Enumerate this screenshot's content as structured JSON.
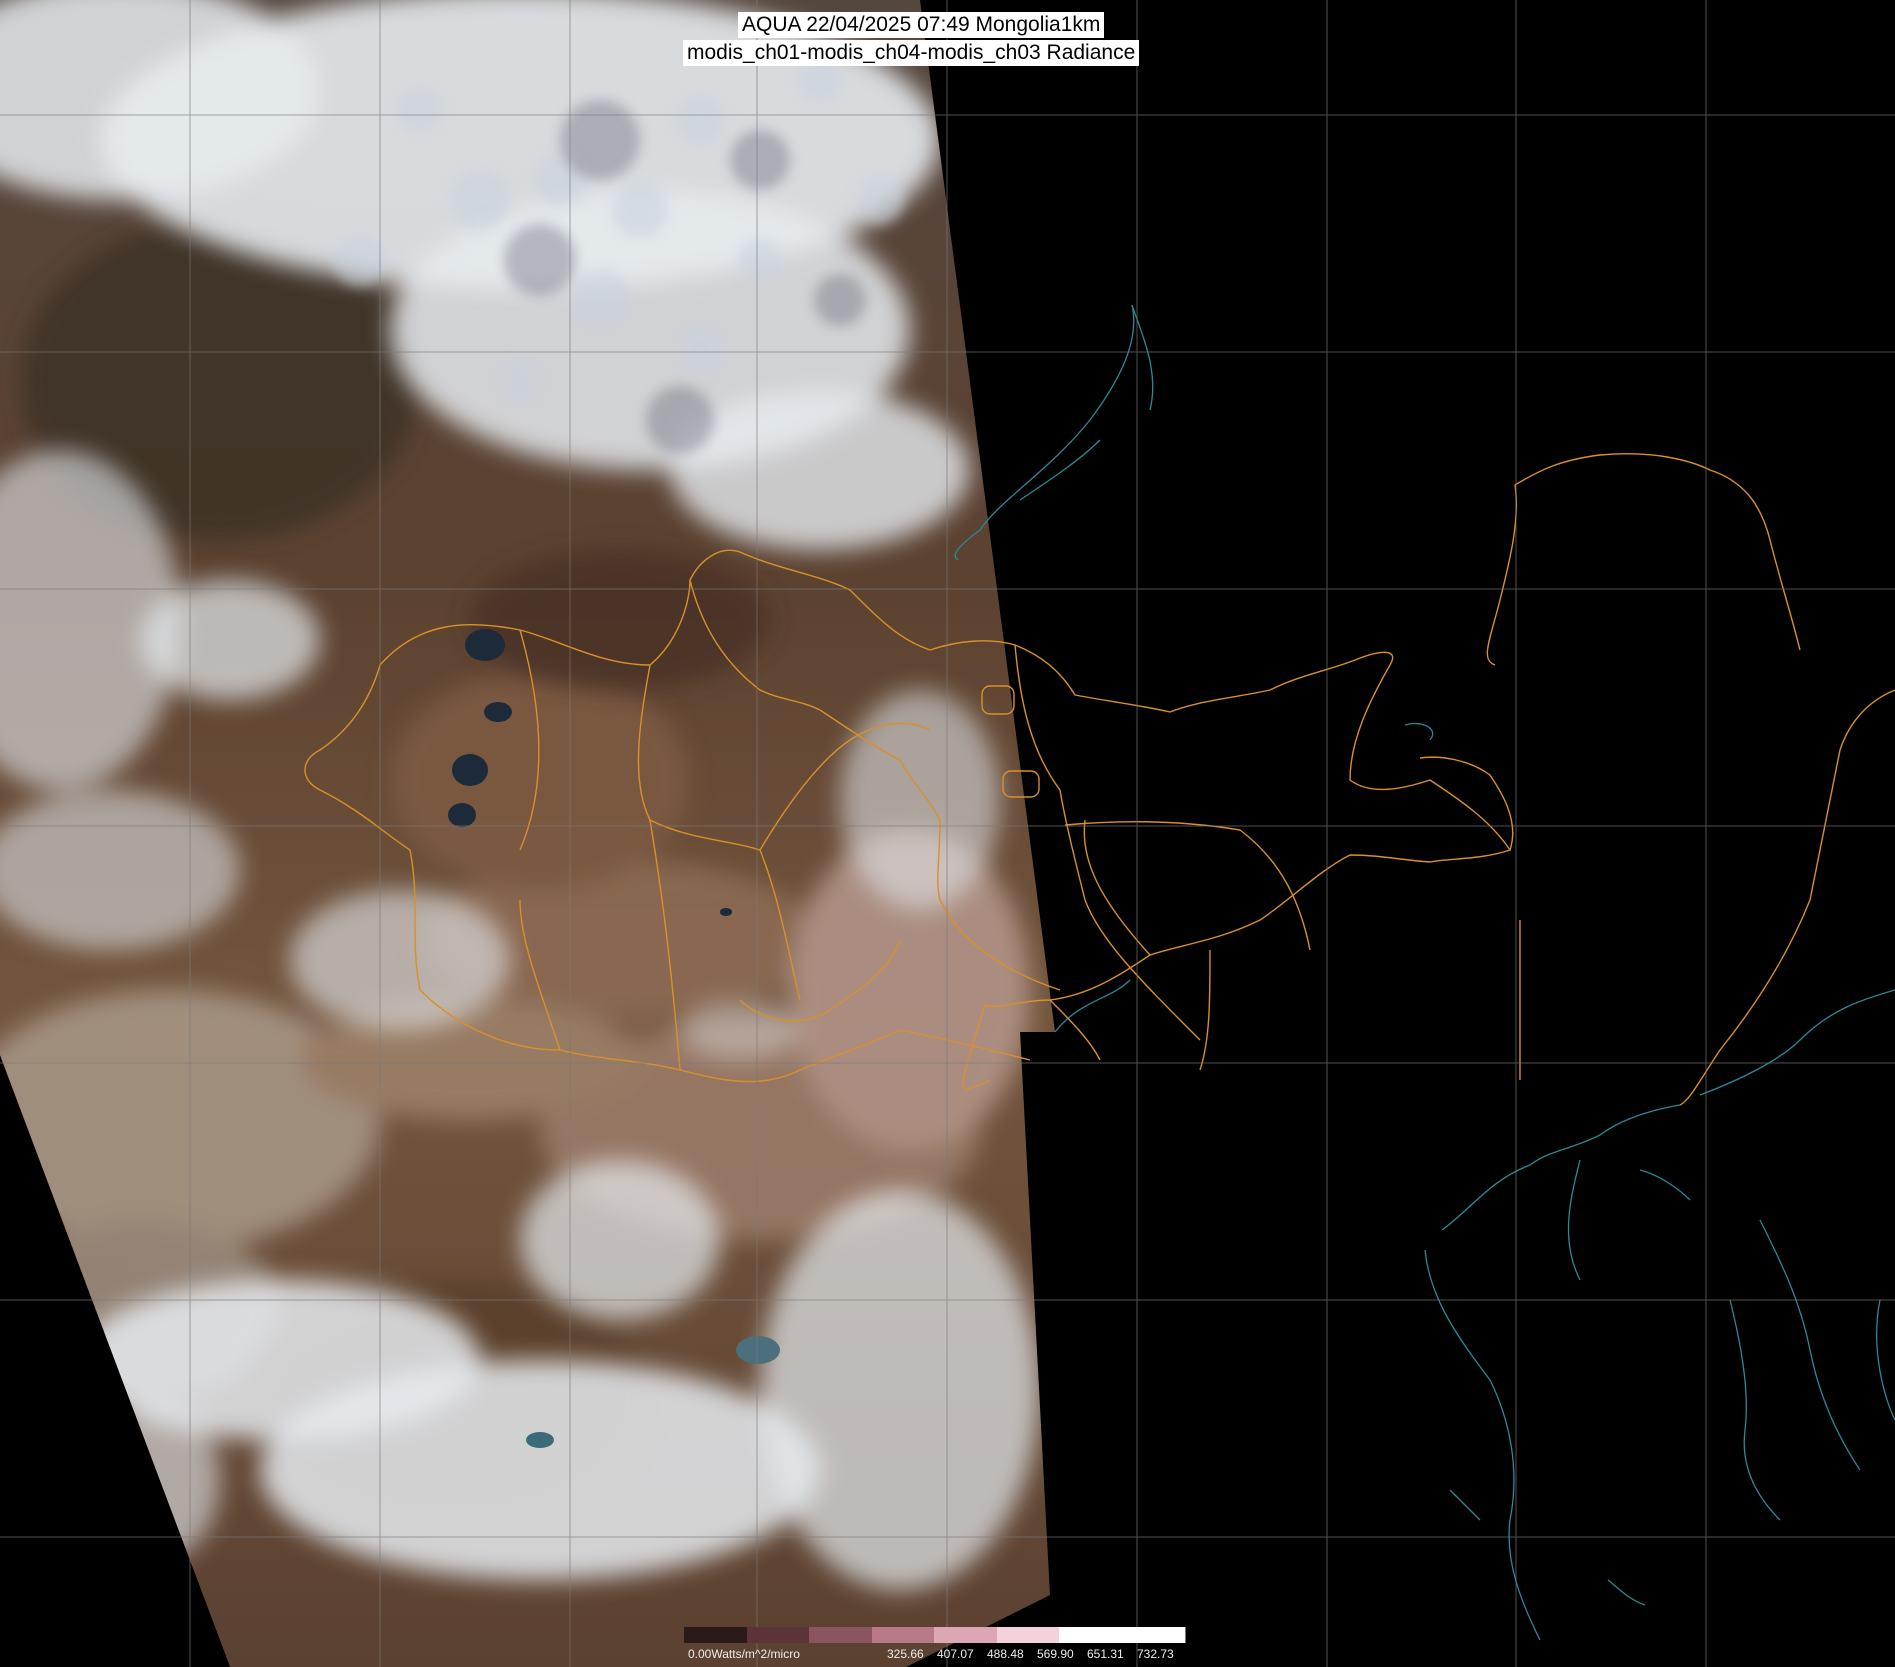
{
  "title": {
    "line1": "AQUA 22/04/2025 07:49 Mongolia1km",
    "line2": "modis_ch01-modis_ch04-modis_ch03 Radiance"
  },
  "colorbar": {
    "unit_label": "0.00Watts/m^2/micro",
    "ticks": [
      "325.66",
      "407.07",
      "488.48",
      "569.90",
      "651.31",
      "732.73"
    ],
    "colors": [
      "#2a1a1a",
      "#5a3438",
      "#8a5560",
      "#b87a88",
      "#dca6b4",
      "#f3d2dc",
      "#ffffff",
      "#ffffff"
    ]
  },
  "colors": {
    "background": "#000000",
    "grid": "#7a7a7a",
    "admin_border": "#d9902a",
    "coastline": "#2a8a95",
    "land": "#6b4a35",
    "desert": "#9c8066",
    "cloud": "#e8ecf0"
  }
}
